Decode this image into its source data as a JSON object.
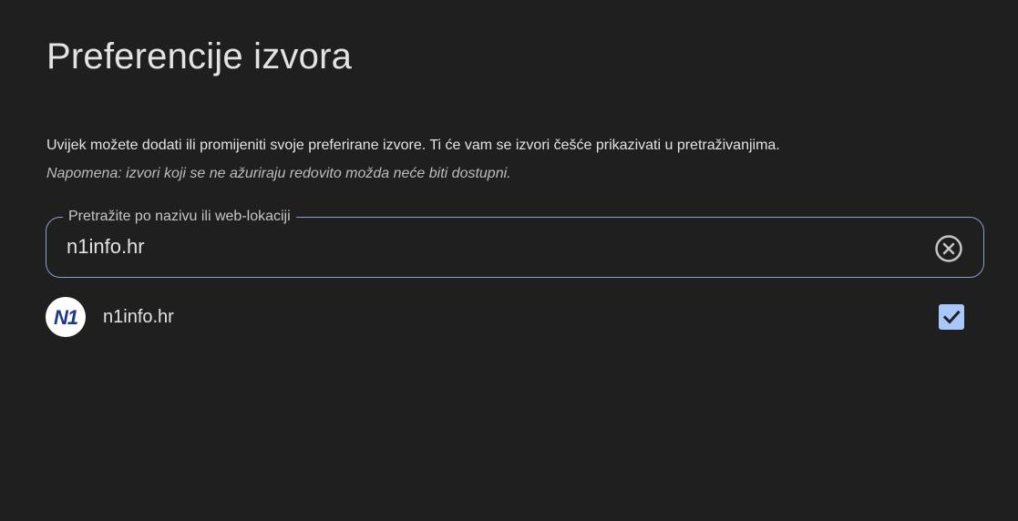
{
  "page": {
    "title": "Preferencije izvora",
    "description": "Uvijek možete dodati ili promijeniti svoje preferirane izvore. Ti će vam se izvori češće prikazivati u pretraživanjima.",
    "note": "Napomena: izvori koji se ne ažuriraju redovito možda neće biti dostupni."
  },
  "search": {
    "label": "Pretražite po nazivu ili web-lokaciji",
    "value": "n1info.hr",
    "clear_icon": "clear-circle-icon"
  },
  "results": [
    {
      "name": "n1info.hr",
      "logo_text": "N1",
      "logo_icon": "n1-logo-icon",
      "checked": true
    }
  ],
  "colors": {
    "background": "#1f1f1f",
    "accent": "#a8c7fa",
    "field_border": "#8e9fc9",
    "logo_blue": "#1b3a8c"
  }
}
